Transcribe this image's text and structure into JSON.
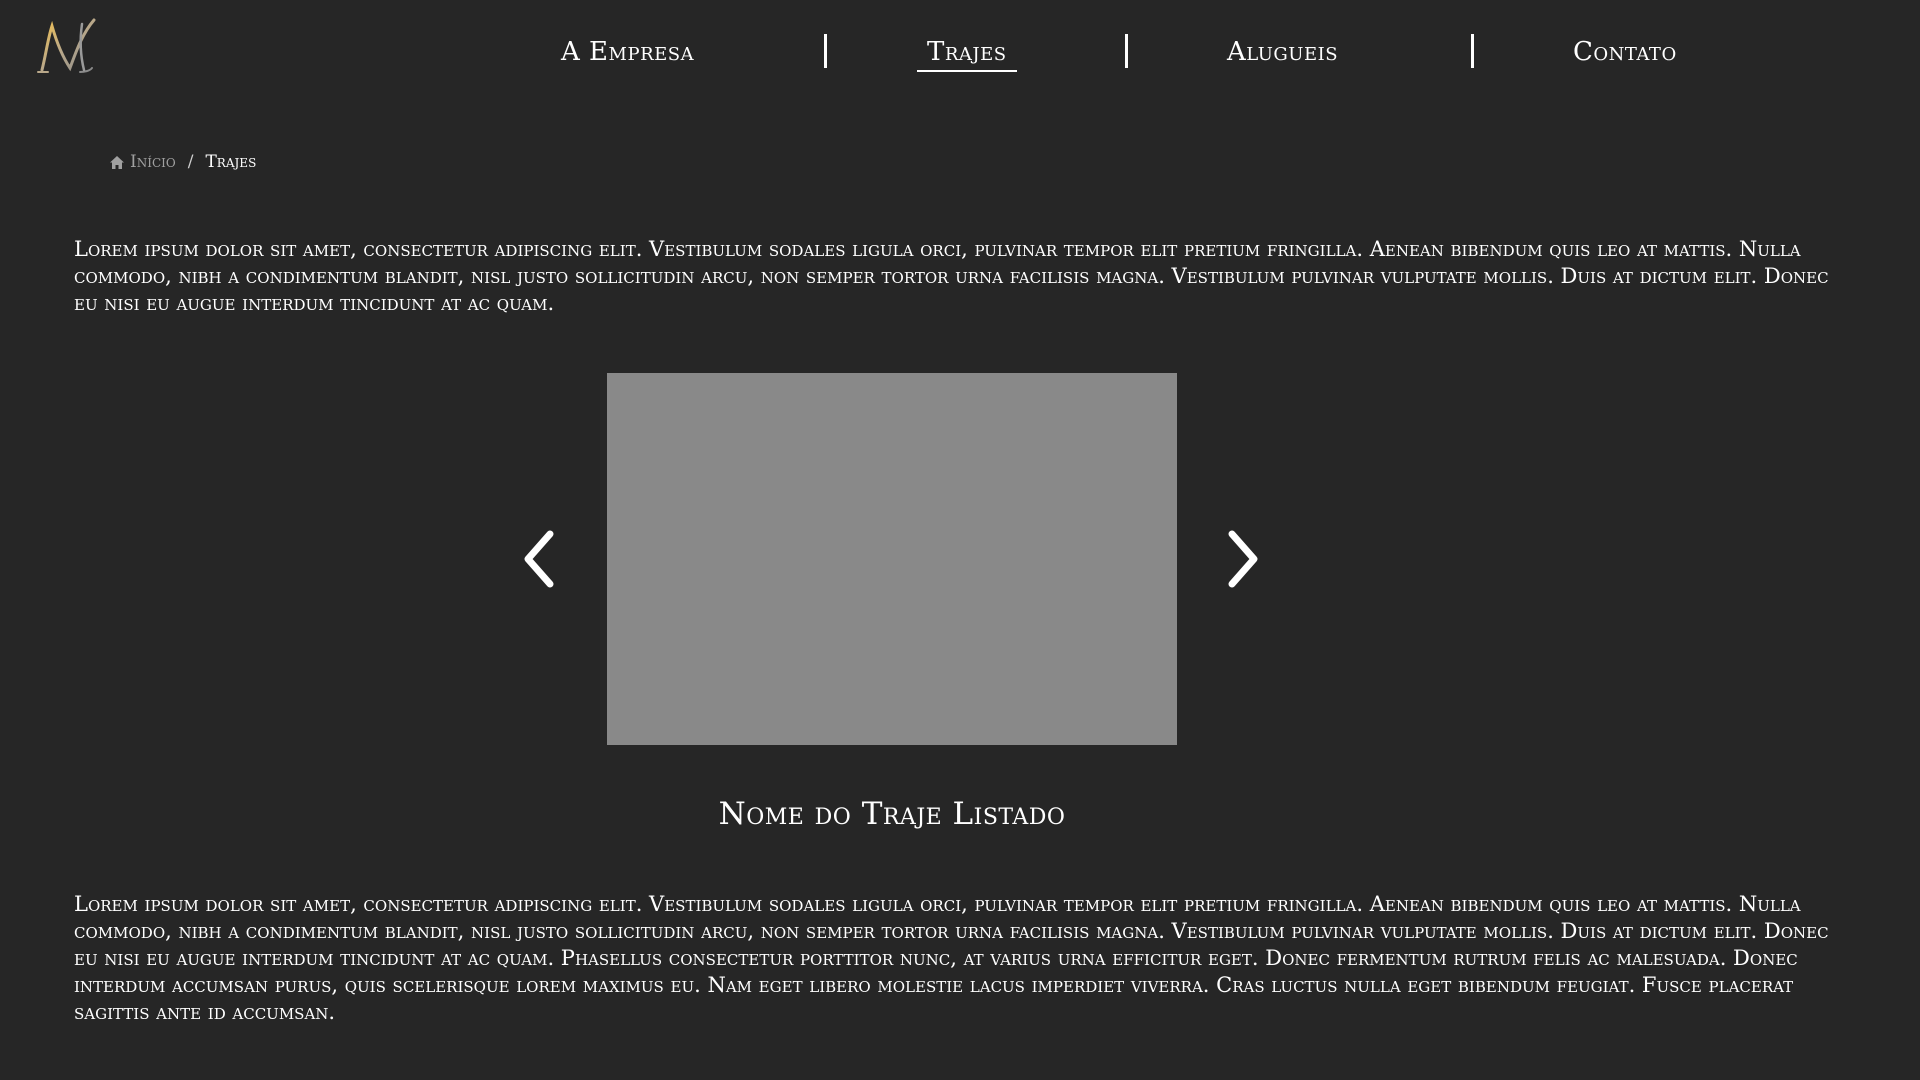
{
  "logo": {
    "letter": "M",
    "accent": "#d9a13b"
  },
  "nav": {
    "items": [
      {
        "label": "A Empresa"
      },
      {
        "label": "Trajes",
        "active": true
      },
      {
        "label": "Alugueis"
      },
      {
        "label": "Contato"
      }
    ]
  },
  "breadcrumb": {
    "home_icon": "home-icon",
    "home_label": "Início",
    "separator": "/",
    "current": "Trajes"
  },
  "intro": "Lorem ipsum dolor sit amet, consectetur adipiscing elit. Vestibulum sodales ligula orci, pulvinar tempor elit pretium fringilla. Aenean bibendum quis leo at mattis. Nulla commodo, nibh a condimentum blandit, nisl justo sollicitudin arcu, non semper tortor urna facilisis magna. Vestibulum pulvinar vulputate mollis. Duis at dictum elit. Donec eu nisi eu augue interdum tincidunt at ac quam.",
  "carousel": {
    "prev_icon": "chevron-left-icon",
    "next_icon": "chevron-right-icon",
    "image_placeholder_color": "#898989",
    "item_title": "Nome do Traje Listado"
  },
  "description": "Lorem ipsum dolor sit amet, consectetur adipiscing elit. Vestibulum sodales ligula orci, pulvinar tempor elit pretium fringilla. Aenean bibendum quis leo at mattis. Nulla commodo, nibh a condimentum blandit, nisl justo sollicitudin arcu, non semper tortor urna facilisis magna. Vestibulum pulvinar vulputate mollis. Duis at dictum elit. Donec eu nisi eu augue interdum tincidunt at ac quam. Phasellus consectetur porttitor nunc, at varius urna efficitur eget. Donec fermentum rutrum felis ac malesuada. Donec interdum accumsan purus, quis scelerisque lorem maximus eu. Nam eget libero molestie lacus imperdiet viverra. Cras luctus nulla eget bibendum feugiat. Fusce placerat sagittis ante id accumsan."
}
